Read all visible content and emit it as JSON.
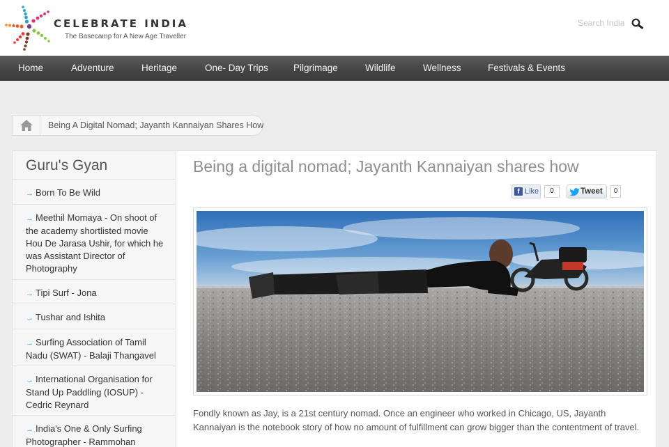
{
  "header": {
    "brand": "CELEBRATE INDIA",
    "tagline": "The Basecamp for A New Age Traveller",
    "search": {
      "placeholder": "Search India"
    }
  },
  "nav": {
    "items": [
      {
        "label": "Home"
      },
      {
        "label": "Adventure"
      },
      {
        "label": "Heritage"
      },
      {
        "label": "One- Day Trips"
      },
      {
        "label": "Pilgrimage"
      },
      {
        "label": "Wildlife"
      },
      {
        "label": "Wellness"
      },
      {
        "label": "Festivals & Events"
      }
    ]
  },
  "breadcrumb": {
    "current": "Being A Digital Nomad; Jayanth Kannaiyan Shares How"
  },
  "sidebar": {
    "title": "Guru's Gyan",
    "items": [
      {
        "label": "Born To Be Wild"
      },
      {
        "label": "Meethil Momaya - On shoot of the academy shortlisted movie Hou De Jarasa Ushir, for which he was Assistant Director of Photography"
      },
      {
        "label": "Tipi Surf - Jona"
      },
      {
        "label": "Tushar and Ishita"
      },
      {
        "label": "Surfing Association of Tamil Nadu (SWAT) - Balaji Thangavel"
      },
      {
        "label": "International Organisation for Stand Up Paddling (IOSUP) - Cedric Reynard"
      },
      {
        "label": "India's One & Only Surfing Photographer - Rammohan"
      }
    ]
  },
  "article": {
    "title": "Being a digital nomad; Jayanth Kannaiyan shares how",
    "social": {
      "like_label": "Like",
      "like_count": "0",
      "tweet_label": "Tweet",
      "tweet_count": "0"
    },
    "body": "Fondly known as Jay, is a 21st century nomad. Once an engineer who worked in Chicago, US, Jayanth Kannaiyan is the notebook story of how no amount of fulfillment can grow bigger than the contentment of travel."
  },
  "colors": {
    "nav_background": "#444444",
    "link_arrow": "#3a8fd0",
    "facebook": "#3b5998",
    "twitter": "#1da1f2"
  },
  "icons": {
    "logo": "starburst-logo-icon",
    "search": "magnifier-icon",
    "home": "home-icon",
    "facebook": "facebook-icon",
    "twitter": "twitter-bird-icon"
  }
}
